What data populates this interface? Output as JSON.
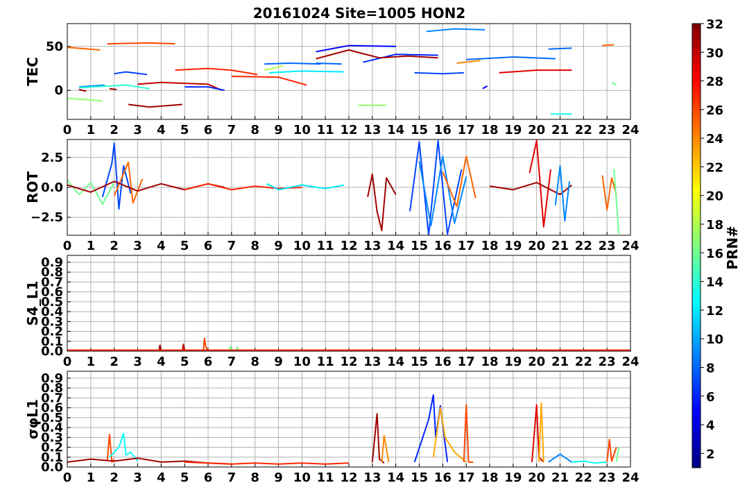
{
  "chart_data": {
    "title": "20161024 Site=1005 HON2",
    "type": "line",
    "x_ticks": [
      "0",
      "1",
      "2",
      "3",
      "4",
      "5",
      "6",
      "7",
      "8",
      "9",
      "10",
      "11",
      "12",
      "13",
      "14",
      "15",
      "16",
      "17",
      "18",
      "19",
      "20",
      "21",
      "22",
      "23",
      "24"
    ],
    "xlim": [
      0,
      24
    ],
    "grid": true,
    "colorbar": {
      "label": "PRN#",
      "ticks": [
        "2",
        "4",
        "6",
        "8",
        "10",
        "12",
        "14",
        "16",
        "18",
        "20",
        "22",
        "24",
        "26",
        "28",
        "30",
        "32"
      ],
      "range": [
        1,
        32
      ],
      "colormap": "jet",
      "colors": [
        "#00007f",
        "#0000ff",
        "#007fff",
        "#00ffff",
        "#7fff7f",
        "#ffff00",
        "#ff7f00",
        "#ff0000",
        "#7f0000"
      ]
    },
    "panels": [
      {
        "ylabel": "TEC",
        "ylim": [
          -33,
          76
        ],
        "y_ticks": [
          "0",
          "50"
        ],
        "series": [
          {
            "prn": 25,
            "x": [
              0,
              1.4
            ],
            "y": [
              49,
              46
            ]
          },
          {
            "prn": 9,
            "x": [
              0.5,
              1.6
            ],
            "y": [
              4,
              6
            ]
          },
          {
            "prn": 14,
            "x": [
              0.5,
              2.5,
              3.5
            ],
            "y": [
              3,
              6,
              2
            ]
          },
          {
            "prn": 31,
            "x": [
              0.5,
              0.8
            ],
            "y": [
              1,
              -1
            ]
          },
          {
            "prn": 17,
            "x": [
              0,
              1.5
            ],
            "y": [
              -9,
              -12
            ]
          },
          {
            "prn": 26,
            "x": [
              1.7,
              3.5,
              4.6
            ],
            "y": [
              53,
              54,
              53
            ]
          },
          {
            "prn": 7,
            "x": [
              2,
              2.5,
              3.4
            ],
            "y": [
              19,
              21,
              18
            ]
          },
          {
            "prn": 31,
            "x": [
              1.8,
              2.1
            ],
            "y": [
              2,
              1
            ]
          },
          {
            "prn": 31,
            "x": [
              2.6,
              3.5,
              4.9
            ],
            "y": [
              -16,
              -19,
              -16
            ]
          },
          {
            "prn": 30,
            "x": [
              3,
              4,
              6,
              6.6
            ],
            "y": [
              7,
              9,
              7,
              0
            ]
          },
          {
            "prn": 27,
            "x": [
              4.6,
              6,
              7,
              8.1
            ],
            "y": [
              23,
              25,
              23,
              18
            ]
          },
          {
            "prn": 6,
            "x": [
              5,
              6,
              6.7
            ],
            "y": [
              4,
              4,
              0
            ]
          },
          {
            "prn": 27,
            "x": [
              7,
              9,
              10.2
            ],
            "y": [
              16,
              15,
              6
            ]
          },
          {
            "prn": 8,
            "x": [
              8.4,
              9.5,
              10.8
            ],
            "y": [
              30,
              31,
              30
            ]
          },
          {
            "prn": 12,
            "x": [
              8.6,
              10,
              11.8
            ],
            "y": [
              20,
              22,
              21
            ]
          },
          {
            "prn": 18,
            "x": [
              8.4,
              9.2
            ],
            "y": [
              23,
              28
            ]
          },
          {
            "prn": 5,
            "x": [
              10.6,
              12,
              14
            ],
            "y": [
              44,
              51,
              50
            ]
          },
          {
            "prn": 31,
            "x": [
              10.6,
              12,
              13.3
            ],
            "y": [
              36,
              46,
              37
            ]
          },
          {
            "prn": 8,
            "x": [
              10.6,
              11.7
            ],
            "y": [
              31,
              30
            ]
          },
          {
            "prn": 6,
            "x": [
              12.6,
              14,
              15.8
            ],
            "y": [
              32,
              41,
              40
            ]
          },
          {
            "prn": 31,
            "x": [
              13.3,
              14.5,
              15.8
            ],
            "y": [
              37,
              39,
              37
            ]
          },
          {
            "prn": 17,
            "x": [
              12.4,
              13.6
            ],
            "y": [
              -17,
              -17
            ]
          },
          {
            "prn": 7,
            "x": [
              14.8,
              16,
              16.9
            ],
            "y": [
              20,
              19,
              20
            ]
          },
          {
            "prn": 9,
            "x": [
              15.3,
              16.5,
              17.8
            ],
            "y": [
              67,
              70,
              69
            ]
          },
          {
            "prn": 24,
            "x": [
              16.6,
              17.6
            ],
            "y": [
              31,
              34
            ]
          },
          {
            "prn": 8,
            "x": [
              17,
              19,
              20.8
            ],
            "y": [
              35,
              38,
              36
            ]
          },
          {
            "prn": 5,
            "x": [
              17.7,
              17.9
            ],
            "y": [
              2,
              5
            ]
          },
          {
            "prn": 29,
            "x": [
              18.4,
              20,
              21.5
            ],
            "y": [
              20,
              23,
              23
            ]
          },
          {
            "prn": 8,
            "x": [
              20.5,
              21.5
            ],
            "y": [
              47,
              48
            ]
          },
          {
            "prn": 13,
            "x": [
              20.6,
              21.5
            ],
            "y": [
              -27,
              -27
            ]
          },
          {
            "prn": 25,
            "x": [
              22.8,
              23.3
            ],
            "y": [
              51,
              52
            ]
          },
          {
            "prn": 16,
            "x": [
              23.2,
              23.4
            ],
            "y": [
              9,
              6
            ]
          }
        ]
      },
      {
        "ylabel": "ROT",
        "ylim": [
          -4,
          4
        ],
        "y_ticks": [
          "−2.5",
          "0.0",
          "2.5"
        ],
        "series": [
          {
            "prn": 16,
            "x": [
              0,
              0.5,
              1,
              1.5,
              2
            ],
            "y": [
              0.6,
              -0.6,
              0.4,
              -1.4,
              0.4
            ]
          },
          {
            "prn": 7,
            "x": [
              1.5,
              1.9,
              2,
              2.2,
              2.4,
              2.7
            ],
            "y": [
              -0.8,
              2.0,
              3.7,
              -1.8,
              1.8,
              -0.5
            ]
          },
          {
            "prn": 25,
            "x": [
              2,
              2.6,
              2.8,
              3.2
            ],
            "y": [
              -0.7,
              2.1,
              -1.3,
              0.7
            ]
          },
          {
            "prn": 31,
            "x": [
              0,
              1,
              2,
              3,
              4,
              5,
              6,
              6.7
            ],
            "y": [
              0.2,
              -0.4,
              0.5,
              -0.3,
              0.3,
              -0.2,
              0.3,
              0
            ]
          },
          {
            "prn": 27,
            "x": [
              5,
              6,
              7,
              8,
              9,
              10
            ],
            "y": [
              -0.2,
              0.3,
              -0.2,
              0.1,
              -0.1,
              0
            ]
          },
          {
            "prn": 12,
            "x": [
              8.5,
              9,
              10,
              11,
              11.8
            ],
            "y": [
              0.3,
              -0.2,
              0.2,
              -0.1,
              0.2
            ]
          },
          {
            "prn": 31,
            "x": [
              12.8,
              13,
              13.2,
              13.4,
              13.6,
              14
            ],
            "y": [
              -0.8,
              1.1,
              -2.0,
              -3.6,
              0.8,
              -0.6
            ]
          },
          {
            "prn": 7,
            "x": [
              14.6,
              15,
              15.4,
              15.8,
              16.2,
              16.8
            ],
            "y": [
              -2.0,
              3.8,
              -4.0,
              3.9,
              -3.9,
              1.5
            ]
          },
          {
            "prn": 9,
            "x": [
              15,
              15.5,
              16,
              16.5,
              17
            ],
            "y": [
              2.2,
              -3.2,
              2.6,
              -3.0,
              0.9
            ]
          },
          {
            "prn": 25,
            "x": [
              16,
              16.6,
              17,
              17.4
            ],
            "y": [
              1.3,
              -1.6,
              2.6,
              -0.9
            ]
          },
          {
            "prn": 29,
            "x": [
              19.7,
              20,
              20.3,
              20.6
            ],
            "y": [
              1.2,
              3.9,
              -3.3,
              1.5
            ]
          },
          {
            "prn": 31,
            "x": [
              18,
              19,
              20,
              21,
              21.5
            ],
            "y": [
              0.1,
              -0.2,
              0.4,
              -0.6,
              0.2
            ]
          },
          {
            "prn": 9,
            "x": [
              20.8,
              21,
              21.2,
              21.4
            ],
            "y": [
              -1.5,
              1.8,
              -2.8,
              0.5
            ]
          },
          {
            "prn": 25,
            "x": [
              22.8,
              23,
              23.2,
              23.4
            ],
            "y": [
              1.0,
              -1.9,
              0.8,
              -0.6
            ]
          },
          {
            "prn": 16,
            "x": [
              23.3,
              23.5
            ],
            "y": [
              1.5,
              -3.9
            ]
          }
        ]
      },
      {
        "ylabel": "S4_L1",
        "ylim": [
          0,
          0.97
        ],
        "y_ticks": [
          "0.0",
          "0.1",
          "0.2",
          "0.3",
          "0.4",
          "0.5",
          "0.6",
          "0.7",
          "0.8",
          "0.9"
        ],
        "series": [
          {
            "prn": 31,
            "x": [
              3.9,
              3.95,
              4.0
            ],
            "y": [
              0,
              0.06,
              0
            ]
          },
          {
            "prn": 30,
            "x": [
              4.9,
              4.95,
              5.0
            ],
            "y": [
              0,
              0.07,
              0
            ]
          },
          {
            "prn": 26,
            "x": [
              5.8,
              5.85,
              5.9,
              6.0
            ],
            "y": [
              0,
              0.13,
              0.05,
              0
            ]
          },
          {
            "prn": 16,
            "x": [
              6.9,
              6.95,
              7.0,
              7.2,
              7.25,
              7.3
            ],
            "y": [
              0,
              0.05,
              0,
              0,
              0.04,
              0
            ]
          },
          {
            "prn": 27,
            "x": [
              0,
              6,
              12,
              18,
              24
            ],
            "y": [
              0.01,
              0.01,
              0.01,
              0.01,
              0.01
            ]
          }
        ]
      },
      {
        "ylabel": "σφL1",
        "ylim": [
          0,
          0.97
        ],
        "y_ticks": [
          "0.0",
          "0.1",
          "0.2",
          "0.3",
          "0.4",
          "0.5",
          "0.6",
          "0.7",
          "0.8",
          "0.9"
        ],
        "series": [
          {
            "prn": 26,
            "x": [
              1.7,
              1.8,
              1.9,
              2.0
            ],
            "y": [
              0.06,
              0.33,
              0.05,
              0.08
            ]
          },
          {
            "prn": 13,
            "x": [
              1.8,
              2.2,
              2.4,
              2.5,
              2.7,
              3.0
            ],
            "y": [
              0.1,
              0.2,
              0.34,
              0.12,
              0.15,
              0.06
            ]
          },
          {
            "prn": 31,
            "x": [
              0,
              1,
              2,
              3,
              4,
              5,
              6,
              7
            ],
            "y": [
              0.05,
              0.08,
              0.06,
              0.09,
              0.05,
              0.06,
              0.04,
              0.03
            ]
          },
          {
            "prn": 27,
            "x": [
              5,
              6,
              7,
              8,
              9,
              10,
              11,
              12
            ],
            "y": [
              0.05,
              0.04,
              0.03,
              0.04,
              0.03,
              0.04,
              0.03,
              0.04
            ]
          },
          {
            "prn": 31,
            "x": [
              13.0,
              13.2,
              13.3,
              13.5
            ],
            "y": [
              0.05,
              0.54,
              0.08,
              0.04
            ]
          },
          {
            "prn": 24,
            "x": [
              13.4,
              13.5,
              13.7
            ],
            "y": [
              0.05,
              0.32,
              0.05
            ]
          },
          {
            "prn": 6,
            "x": [
              14.8,
              15.4,
              15.6,
              15.7,
              15.9,
              16.2
            ],
            "y": [
              0.05,
              0.48,
              0.73,
              0.3,
              0.62,
              0.05
            ]
          },
          {
            "prn": 23,
            "x": [
              15.6,
              15.9,
              16.1,
              16.5,
              17.0
            ],
            "y": [
              0.1,
              0.6,
              0.3,
              0.15,
              0.05
            ]
          },
          {
            "prn": 26,
            "x": [
              16.9,
              17.0,
              17.1,
              17.3
            ],
            "y": [
              0.05,
              0.63,
              0.05,
              0.05
            ]
          },
          {
            "prn": 29,
            "x": [
              19.8,
              20.0,
              20.1,
              20.3
            ],
            "y": [
              0.05,
              0.63,
              0.1,
              0.05
            ]
          },
          {
            "prn": 23,
            "x": [
              20.1,
              20.2,
              20.3
            ],
            "y": [
              0.05,
              0.65,
              0.05
            ]
          },
          {
            "prn": 9,
            "x": [
              20.5,
              21,
              21.5
            ],
            "y": [
              0.05,
              0.13,
              0.05
            ]
          },
          {
            "prn": 13,
            "x": [
              21.5,
              22,
              22.5,
              23
            ],
            "y": [
              0.05,
              0.06,
              0.04,
              0.05
            ]
          },
          {
            "prn": 26,
            "x": [
              23.0,
              23.1,
              23.2,
              23.4
            ],
            "y": [
              0.05,
              0.28,
              0.06,
              0.2
            ]
          },
          {
            "prn": 16,
            "x": [
              23.4,
              23.5
            ],
            "y": [
              0.05,
              0.2
            ]
          }
        ]
      }
    ]
  }
}
